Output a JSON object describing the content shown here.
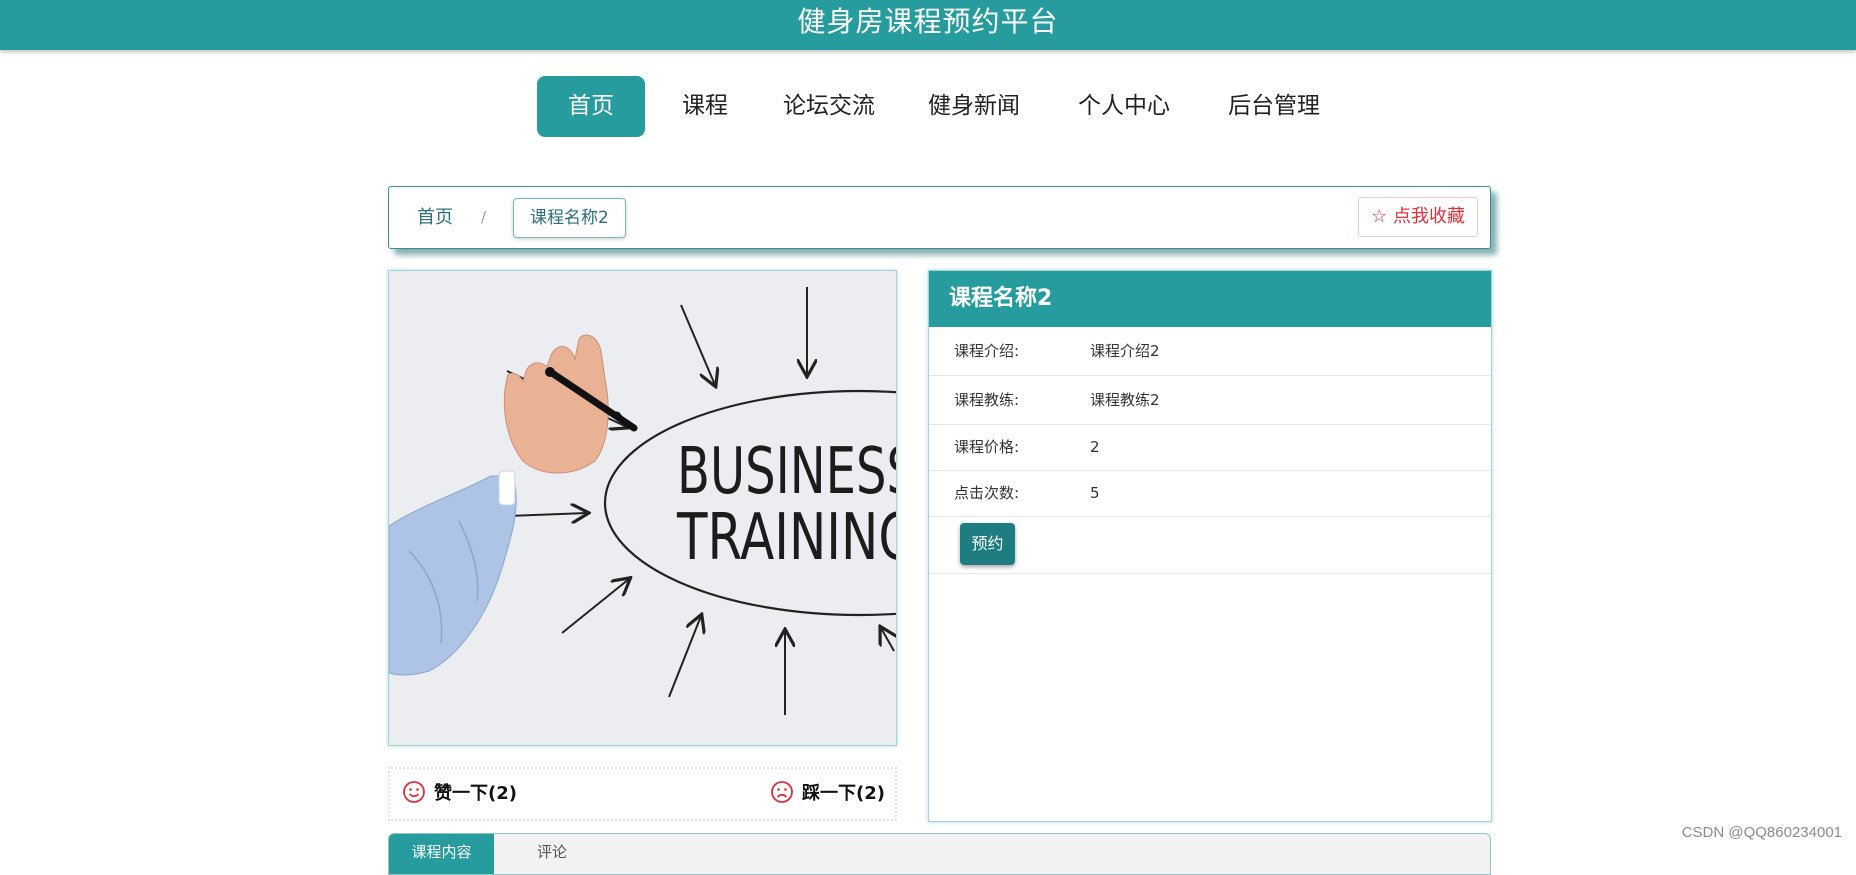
{
  "header": {
    "title": "健身房课程预约平台"
  },
  "nav": {
    "items": [
      {
        "label": "首页"
      },
      {
        "label": "课程"
      },
      {
        "label": "论坛交流"
      },
      {
        "label": "健身新闻"
      },
      {
        "label": "个人中心"
      },
      {
        "label": "后台管理"
      }
    ]
  },
  "breadcrumb": {
    "home": "首页",
    "separator": "/",
    "current": "课程名称2",
    "favorite": "点我收藏"
  },
  "image": {
    "line1": "BUSINESS",
    "line2": "TRAINING"
  },
  "votes": {
    "like": "赞一下(2)",
    "dislike": "踩一下(2)"
  },
  "course": {
    "name": "课程名称2",
    "rows": [
      {
        "label": "课程介绍:",
        "value": "课程介绍2"
      },
      {
        "label": "课程教练:",
        "value": "课程教练2"
      },
      {
        "label": "课程价格:",
        "value": "2"
      },
      {
        "label": "点击次数:",
        "value": "5"
      }
    ],
    "book": "预约"
  },
  "tabs": {
    "active": "课程内容",
    "other": "评论"
  },
  "watermark": "CSDN @QQ860234001",
  "colors": {
    "primary": "#269c9e",
    "favorite": "#e0313a",
    "vote": "#e0313a"
  }
}
